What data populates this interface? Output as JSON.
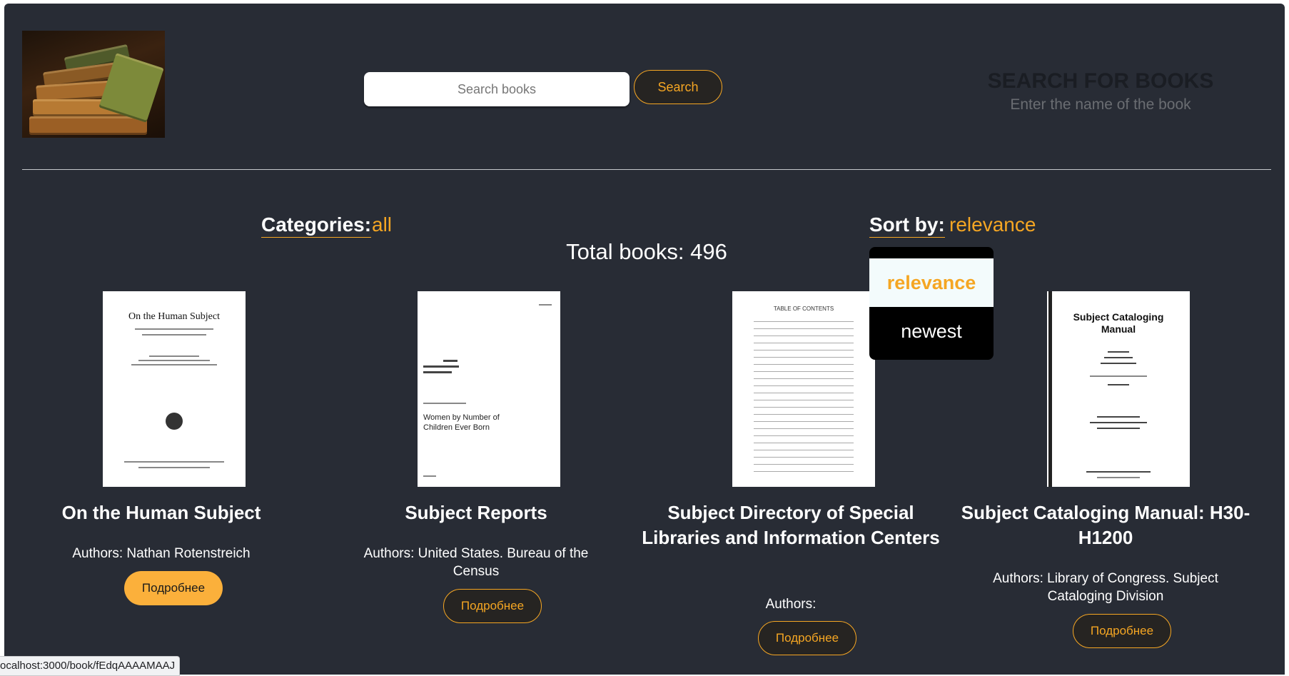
{
  "search": {
    "placeholder": "Search books",
    "button_label": "Search"
  },
  "side_panel": {
    "title": "SEARCH FOR BOOKS",
    "subtitle": "Enter the name of the book"
  },
  "filters": {
    "categories_label": "Categories:",
    "categories_value": "all",
    "sort_label": "Sort by:",
    "sort_value": "relevance"
  },
  "total_books": "Total books: 496",
  "sort_dropdown": {
    "options": [
      "relevance",
      "newest"
    ],
    "selected": "relevance"
  },
  "books": [
    {
      "title": "On the Human Subject",
      "authors": "Authors: Nathan Rotenstreich",
      "button_label": "Подробнее",
      "cover_text": "On the Human Subject"
    },
    {
      "title": "Subject Reports",
      "authors": "Authors: United States. Bureau of the Census",
      "button_label": "Подробнее",
      "cover_text": "Women by Number of Children Ever Born"
    },
    {
      "title": "Subject Directory of Special Libraries and Information Centers",
      "authors": "Authors:",
      "button_label": "Подробнее",
      "cover_text": "TABLE OF CONTENTS"
    },
    {
      "title": "Subject Cataloging Manual: H30-H1200",
      "authors": "Authors: Library of Congress. Subject Cataloging Division",
      "button_label": "Подробнее",
      "cover_text": "Subject Cataloging Manual"
    }
  ],
  "status_bar": {
    "url": "ocalhost:3000/book/fEdqAAAAMAAJ"
  },
  "colors": {
    "background": "#282c35",
    "accent": "#f5a623",
    "accent_filled": "#fbb03b",
    "dropdown_bg": "#000000"
  },
  "icons": {
    "logo": "books-stack-logo"
  }
}
